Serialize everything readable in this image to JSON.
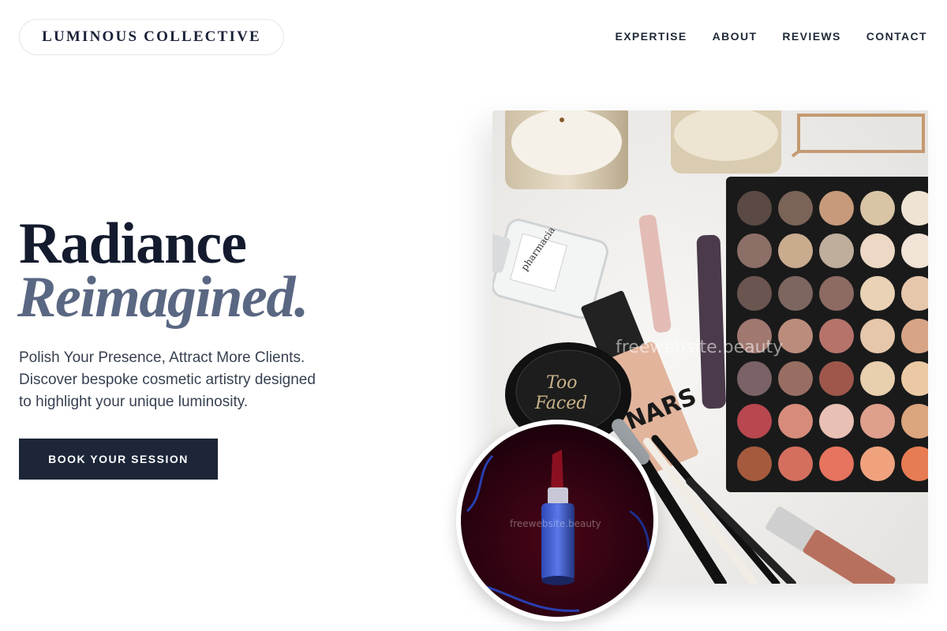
{
  "brand": {
    "name": "LUMINOUS COLLECTIVE"
  },
  "nav": {
    "items": [
      "EXPERTISE",
      "ABOUT",
      "REVIEWS",
      "CONTACT"
    ]
  },
  "hero": {
    "title": "Radiance",
    "title_italic": "Reimagined.",
    "description_lines": [
      "Polish Your Presence, Attract More Clients.",
      "Discover bespoke cosmetic artistry designed",
      "to highlight your unique luminosity."
    ],
    "cta_label": "BOOK YOUR SESSION"
  },
  "images": {
    "main_alt": "Flat lay of makeup: eyeshadow palette, foundation, lipsticks, brushes, candles",
    "main_watermark": "freewebsite.beauty",
    "inset_alt": "Blue lipstick on dark red background",
    "inset_watermark": "freewebsite.beauty"
  },
  "photo_labels": {
    "too_faced": [
      "Too",
      "Faced"
    ],
    "nars": "NARS",
    "perfume": "pharmacia"
  },
  "colors": {
    "primary_dark": "#1c2638",
    "title": "#141b2e",
    "accent_slate": "#5a6782"
  },
  "icons": [
    "palette-image",
    "lipstick-image"
  ]
}
